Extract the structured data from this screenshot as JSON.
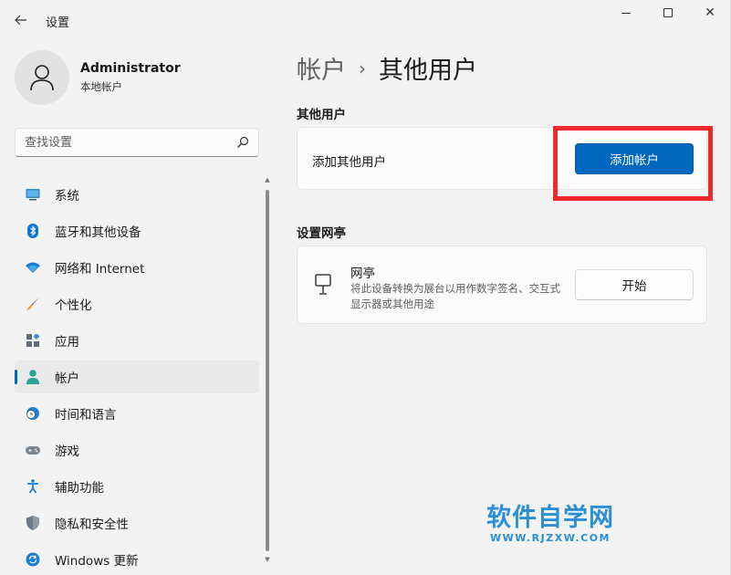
{
  "window": {
    "title": "设置"
  },
  "user": {
    "name": "Administrator",
    "account_type": "本地帐户"
  },
  "search": {
    "placeholder": "查找设置"
  },
  "nav": {
    "items": [
      {
        "label": "系统",
        "icon": "monitor-icon"
      },
      {
        "label": "蓝牙和其他设备",
        "icon": "bluetooth-icon"
      },
      {
        "label": "网络和 Internet",
        "icon": "wifi-icon"
      },
      {
        "label": "个性化",
        "icon": "brush-icon"
      },
      {
        "label": "应用",
        "icon": "apps-icon"
      },
      {
        "label": "帐户",
        "icon": "account-icon",
        "active": true
      },
      {
        "label": "时间和语言",
        "icon": "clock-globe-icon"
      },
      {
        "label": "游戏",
        "icon": "gamepad-icon"
      },
      {
        "label": "辅助功能",
        "icon": "accessibility-icon"
      },
      {
        "label": "隐私和安全性",
        "icon": "shield-icon"
      },
      {
        "label": "Windows 更新",
        "icon": "update-icon"
      }
    ]
  },
  "breadcrumb": {
    "parent": "帐户",
    "separator": "›",
    "current": "其他用户"
  },
  "other_users": {
    "section_title": "其他用户",
    "add_label": "添加其他用户",
    "add_button": "添加帐户"
  },
  "kiosk": {
    "section_title": "设置网亭",
    "title": "网亭",
    "description": "将此设备转换为展台以用作数字签名、交互式显示器或其他用途",
    "button": "开始"
  },
  "watermark": {
    "title": "软件自学网",
    "url": "WWW.RJZXW.COM"
  },
  "colors": {
    "accent": "#0067c0",
    "highlight": "#ee2a2f",
    "watermark": "#2b8ed8"
  }
}
